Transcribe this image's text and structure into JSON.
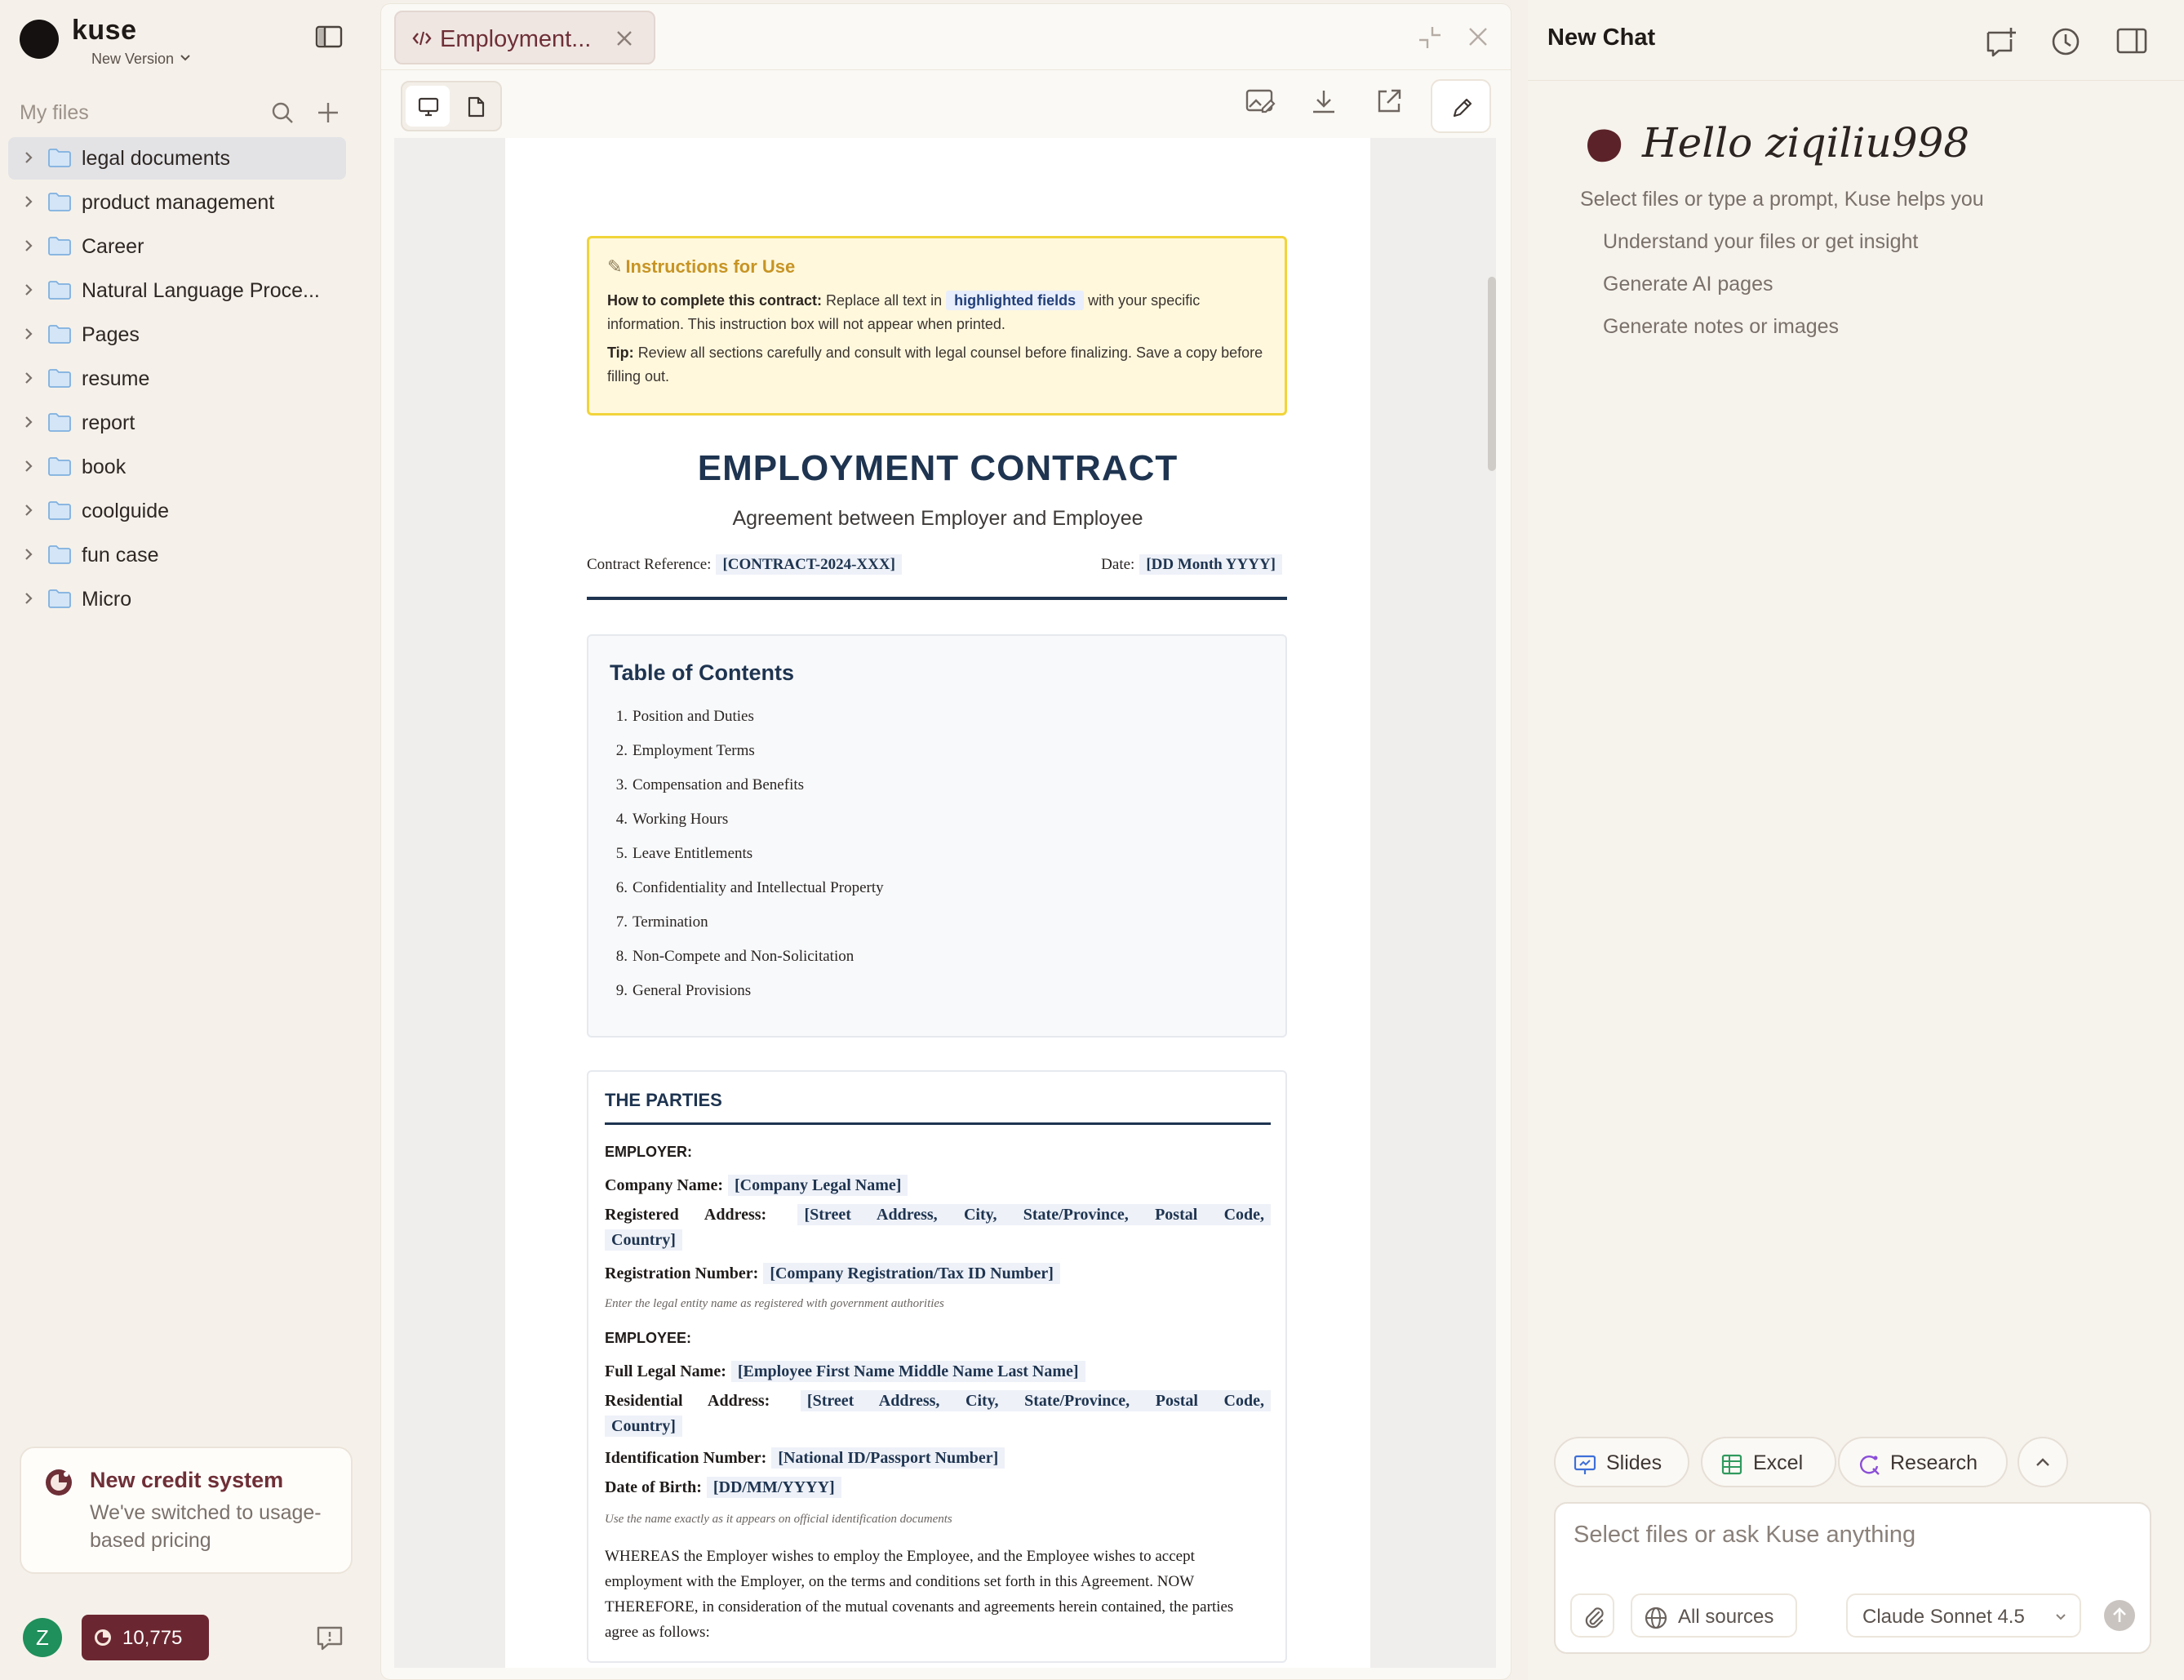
{
  "sidebar": {
    "brand": "kuse",
    "version_label": "New Version",
    "files_title": "My files",
    "folders": [
      {
        "label": "legal documents"
      },
      {
        "label": "product management"
      },
      {
        "label": "Career"
      },
      {
        "label": "Natural Language Proce..."
      },
      {
        "label": "Pages"
      },
      {
        "label": "resume"
      },
      {
        "label": "report"
      },
      {
        "label": "book"
      },
      {
        "label": "coolguide"
      },
      {
        "label": "fun case"
      },
      {
        "label": "Micro"
      }
    ],
    "credit_card": {
      "title": "New credit system",
      "subtitle": "We've switched to usage-based pricing"
    },
    "user": {
      "initial": "Z",
      "credits": "10,775"
    }
  },
  "viewer": {
    "tab_label": "Employment...",
    "document": {
      "instructions": {
        "title": "Instructions for Use",
        "how_label": "How to complete this contract:",
        "how_text_1": "Replace all text in",
        "highlight": "highlighted fields",
        "how_text_2": "with your specific information. This instruction box will not appear when printed.",
        "tip_label": "Tip:",
        "tip_text": "Review all sections carefully and consult with legal counsel before finalizing. Save a copy before filling out."
      },
      "title": "EMPLOYMENT CONTRACT",
      "subtitle": "Agreement between Employer and Employee",
      "ref_label": "Contract Reference:",
      "ref_value": "[CONTRACT-2024-XXX]",
      "date_label": "Date:",
      "date_value": "[DD Month YYYY]",
      "toc": {
        "title": "Table of Contents",
        "items": [
          {
            "num": "1.",
            "label": "Position and Duties"
          },
          {
            "num": "2.",
            "label": "Employment Terms"
          },
          {
            "num": "3.",
            "label": "Compensation and Benefits"
          },
          {
            "num": "4.",
            "label": "Working Hours"
          },
          {
            "num": "5.",
            "label": "Leave Entitlements"
          },
          {
            "num": "6.",
            "label": "Confidentiality and Intellectual Property"
          },
          {
            "num": "7.",
            "label": "Termination"
          },
          {
            "num": "8.",
            "label": "Non-Compete and Non-Solicitation"
          },
          {
            "num": "9.",
            "label": "General Provisions"
          }
        ]
      },
      "parties": {
        "title": "THE PARTIES",
        "employer_label": "EMPLOYER:",
        "company_name_label": "Company Name:",
        "company_name_value": "[Company Legal Name]",
        "reg_address_label": "Registered Address:",
        "reg_address_value_1": "[Street Address, City, State/Province, Postal Code,",
        "reg_address_value_2": "Country]",
        "reg_number_label": "Registration Number:",
        "reg_number_value": "[Company Registration/Tax ID Number]",
        "employer_hint": "Enter the legal entity name as registered with government authorities",
        "employee_label": "EMPLOYEE:",
        "full_name_label": "Full Legal Name:",
        "full_name_value": "[Employee First Name Middle Name Last Name]",
        "res_address_label": "Residential Address:",
        "res_address_value_1": "[Street Address, City, State/Province, Postal Code,",
        "res_address_value_2": "Country]",
        "id_label": "Identification Number:",
        "id_value": "[National ID/Passport Number]",
        "dob_label": "Date of Birth:",
        "dob_value": "[DD/MM/YYYY]",
        "employee_hint": "Use the name exactly as it appears on official identification documents",
        "whereas": "WHEREAS the Employer wishes to employ the Employee, and the Employee wishes to accept employment with the Employer, on the terms and conditions set forth in this Agreement. NOW THEREFORE, in consideration of the mutual covenants and agreements herein contained, the parties agree as follows:"
      }
    }
  },
  "chat": {
    "title": "New Chat",
    "greeting": "Hello ziqiliu998",
    "subtitle": "Select files or type a prompt, Kuse helps you",
    "suggestions": [
      "Understand your files or get insight",
      "Generate AI pages",
      "Generate notes or images"
    ],
    "chips": {
      "slides": "Slides",
      "excel": "Excel",
      "research": "Research"
    },
    "composer": {
      "placeholder": "Select files or ask Kuse anything",
      "sources": "All sources",
      "model": "Claude Sonnet 4.5"
    }
  },
  "colors": {
    "accent": "#6e2f37",
    "navy": "#1e3450",
    "highlight_bg": "#eef1f8",
    "instruction_border": "#f1d43a"
  }
}
